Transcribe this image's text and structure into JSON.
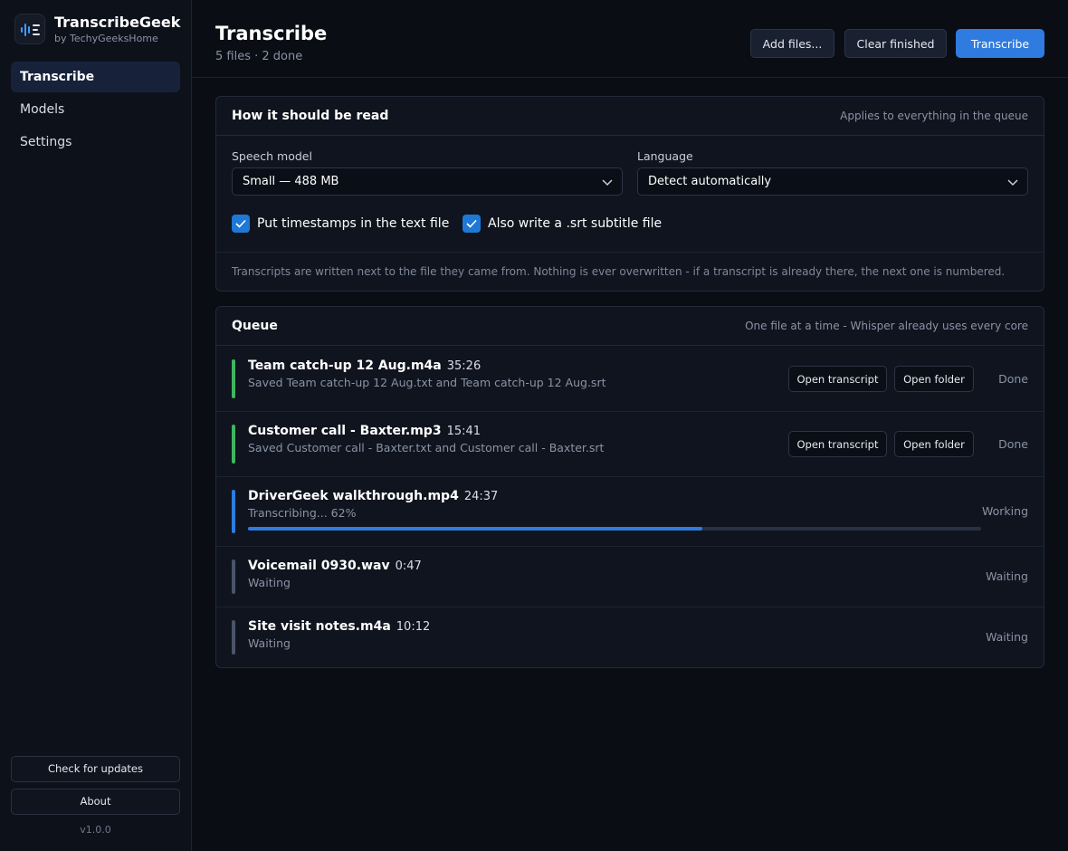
{
  "app": {
    "name": "TranscribeGeek",
    "byline": "by TechyGeeksHome",
    "version": "v1.0.0"
  },
  "nav": {
    "items": [
      {
        "label": "Transcribe",
        "active": true
      },
      {
        "label": "Models",
        "active": false
      },
      {
        "label": "Settings",
        "active": false
      }
    ]
  },
  "sidebar_buttons": {
    "check_updates": "Check for updates",
    "about": "About"
  },
  "header": {
    "title": "Transcribe",
    "subtitle": "5 files · 2 done",
    "add_files": "Add files...",
    "clear_finished": "Clear finished",
    "transcribe": "Transcribe"
  },
  "settings": {
    "title": "How it should be read",
    "note": "Applies to everything in the queue",
    "model_label": "Speech model",
    "model_value": "Small — 488 MB",
    "language_label": "Language",
    "language_value": "Detect automatically",
    "timestamps_label": "Put timestamps in the text file",
    "timestamps_checked": true,
    "srt_label": "Also write a .srt subtitle file",
    "srt_checked": true,
    "footnote": "Transcripts are written next to the file they came from. Nothing is ever overwritten - if a transcript is already there, the next one is numbered."
  },
  "queue": {
    "title": "Queue",
    "note": "One file at a time - Whisper already uses every core",
    "open_transcript": "Open transcript",
    "open_folder": "Open folder",
    "items": [
      {
        "name": "Team catch-up 12 Aug.m4a",
        "duration": "35:26",
        "detail": "Saved Team catch-up 12 Aug.txt and Team catch-up 12 Aug.srt",
        "status": "Done",
        "color": "#3fb560"
      },
      {
        "name": "Customer call - Baxter.mp3",
        "duration": "15:41",
        "detail": "Saved Customer call - Baxter.txt and Customer call - Baxter.srt",
        "status": "Done",
        "color": "#3fb560"
      },
      {
        "name": "DriverGeek walkthrough.mp4",
        "duration": "24:37",
        "detail": "Transcribing... 62%",
        "status": "Working",
        "color": "#2f7be0",
        "progress": 62
      },
      {
        "name": "Voicemail 0930.wav",
        "duration": "0:47",
        "detail": "Waiting",
        "status": "Waiting",
        "color": "#4b5468"
      },
      {
        "name": "Site visit notes.m4a",
        "duration": "10:12",
        "detail": "Waiting",
        "status": "Waiting",
        "color": "#4b5468"
      }
    ]
  },
  "colors": {
    "accent": "#2f7be0",
    "done": "#3fb560",
    "waiting": "#4b5468"
  }
}
